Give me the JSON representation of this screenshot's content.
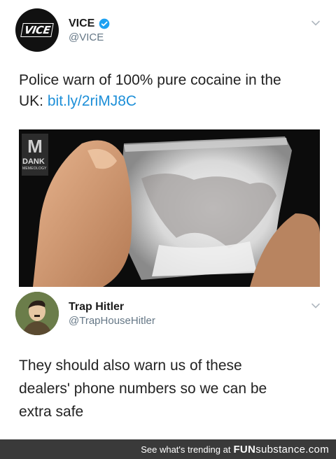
{
  "tweet1": {
    "display_name": "VICE",
    "handle": "@VICE",
    "avatar_text": "VICE",
    "text_line1": "Police warn of 100% pure cocaine in the",
    "text_line2_prefix": "UK: ",
    "link": "bit.ly/2riMJ8C",
    "photo_watermark_top": "DANK",
    "photo_watermark_bottom": "MEMEOLOGY"
  },
  "tweet2": {
    "display_name": "Trap Hitler",
    "handle": "@TrapHouseHitler",
    "text_line1": "They should also warn us of these",
    "text_line2": "dealers' phone numbers so we can be",
    "text_line3": "extra safe"
  },
  "footer": {
    "prefix": "See what's trending at",
    "brand_bold": "FUN",
    "brand_rest": "substance",
    "brand_tld": ".com"
  },
  "colors": {
    "link": "#1d8fd8",
    "verified": "#1da1f2",
    "footer_bg": "#3a3a3a"
  }
}
